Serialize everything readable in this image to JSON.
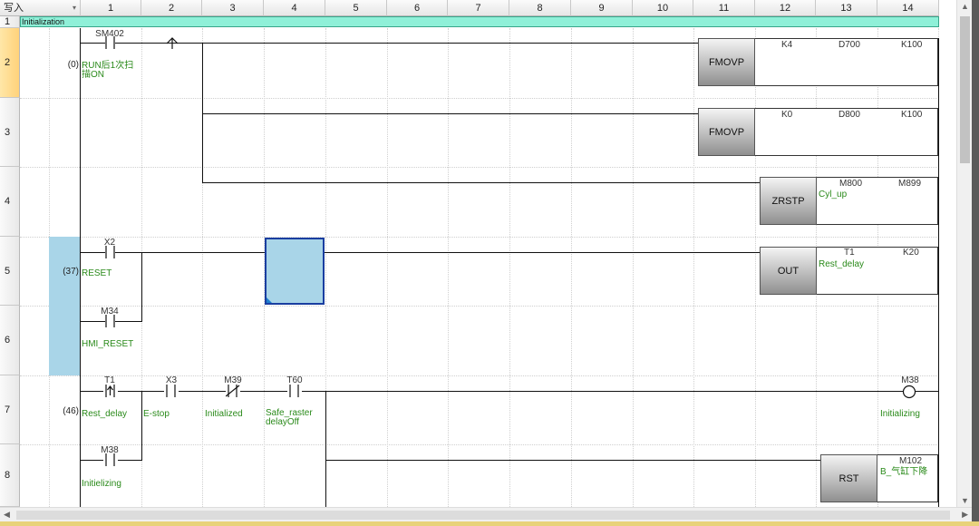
{
  "toolbar": {
    "mode_label": "写入"
  },
  "columns": [
    "1",
    "2",
    "3",
    "4",
    "5",
    "6",
    "7",
    "8",
    "9",
    "10",
    "11",
    "12",
    "13",
    "14"
  ],
  "rows": [
    "1",
    "2",
    "3",
    "4",
    "5",
    "6",
    "7",
    "8"
  ],
  "comment_bar": {
    "text": "Initialization"
  },
  "steps": {
    "s0": "(0)",
    "s37": "(37)",
    "s46": "(46)"
  },
  "contacts": {
    "sm402": {
      "device": "SM402",
      "comment": "RUN后1次扫描ON"
    },
    "x2": {
      "device": "X2",
      "comment": "RESET"
    },
    "m34": {
      "device": "M34",
      "comment": "HMI_RESET"
    },
    "t1": {
      "device": "T1",
      "comment": "Rest_delay"
    },
    "x3": {
      "device": "X3",
      "comment": "E-stop"
    },
    "m39": {
      "device": "M39",
      "comment": "Initialized"
    },
    "t60": {
      "device": "T60",
      "comment": "Safe_raster delayOff"
    },
    "m38c": {
      "device": "M38",
      "comment": "Initielizing"
    }
  },
  "coil_m38": {
    "device": "M38",
    "comment": "Initializing"
  },
  "instructions": {
    "fmovp1": {
      "name": "FMOVP",
      "op1": "K4",
      "op2": "D700",
      "op3": "K100"
    },
    "fmovp2": {
      "name": "FMOVP",
      "op1": "K0",
      "op2": "D800",
      "op3": "K100"
    },
    "zrstp": {
      "name": "ZRSTP",
      "op1": "M800",
      "op1_comment": "Cyl_up",
      "op2": "M899"
    },
    "out": {
      "name": "OUT",
      "op1": "T1",
      "op1_comment": "Rest_delay",
      "op2": "K20"
    },
    "rst": {
      "name": "RST",
      "op1": "M102",
      "op1_comment": "B_气缸下降"
    }
  },
  "colors": {
    "comment_bar": "#8ff0d8",
    "selection": "#a9d5e8",
    "comment_text": "#2a8a1a",
    "row_highlight": "#ffd27a"
  }
}
